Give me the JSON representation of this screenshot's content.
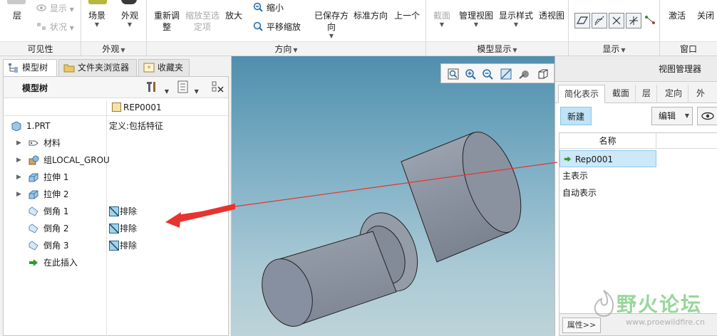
{
  "ribbon": {
    "visibility_group": {
      "label": "可见性",
      "layer_label": "层",
      "show_label": "显示",
      "status_label": "状况"
    },
    "appearance_group": {
      "label": "外观",
      "scene_label": "场景",
      "appearance_label": "外观"
    },
    "orientation_group": {
      "label": "方向",
      "refit_label": "重新调整",
      "zoom_to_selected_label": "缩放至选定项",
      "zoom_in_label": "放大",
      "zoom_out_label": "缩小",
      "pan_zoom_label": "平移缩放",
      "saved_orientations_label": "已保存方向",
      "standard_orientation_label": "标准方向",
      "previous_label": "上一个"
    },
    "model_display_group": {
      "label": "模型显示",
      "section_label": "截面",
      "manage_views_label": "管理视图",
      "display_style_label": "显示样式",
      "perspective_label": "透视图"
    },
    "display_group": {
      "label": "显示"
    },
    "window_group": {
      "label": "窗口",
      "activate_label": "激活",
      "close_label": "关闭"
    }
  },
  "left_panel": {
    "tabs": [
      {
        "label": "模型树",
        "icon": "model-tree-icon"
      },
      {
        "label": "文件夹浏览器",
        "icon": "folder-browser-icon"
      },
      {
        "label": "收藏夹",
        "icon": "favorites-icon"
      }
    ],
    "header_title": "模型树",
    "column2_header": "REP0001",
    "rows": [
      {
        "label": "1.PRT",
        "col2": "定义:包括特征",
        "icon": "part-icon"
      },
      {
        "label": "材料",
        "col2": "",
        "icon": "material-icon"
      },
      {
        "label": "组LOCAL_GROU",
        "col2": "",
        "icon": "group-icon"
      },
      {
        "label": "拉伸 1",
        "col2": "",
        "icon": "extrude-icon"
      },
      {
        "label": "拉伸 2",
        "col2": "",
        "icon": "extrude-icon"
      },
      {
        "label": "倒角 1",
        "col2": "排除",
        "icon": "chamfer-icon"
      },
      {
        "label": "倒角 2",
        "col2": "排除",
        "icon": "chamfer-icon"
      },
      {
        "label": "倒角 3",
        "col2": "排除",
        "icon": "chamfer-icon"
      },
      {
        "label": "在此插入",
        "col2": "",
        "icon": "insert-here-icon"
      }
    ]
  },
  "view_manager": {
    "title": "视图管理器",
    "tabs": [
      "简化表示",
      "截面",
      "层",
      "定向",
      "外观"
    ],
    "new_label": "新建",
    "edit_label": "编辑",
    "list_header": "名称",
    "items": [
      "Rep0001",
      "主表示",
      "自动表示"
    ],
    "properties_label": "属性>>"
  },
  "watermark": {
    "text_cn": "野火论坛",
    "url": "www.proewildfire.cn"
  },
  "colors": {
    "accent": "#bfe3f7",
    "selection": "#cde8f9",
    "annotation_arrow": "#e8332e",
    "model_body": "#8e96a4",
    "background_top": "#4f8fad",
    "background_bottom": "#bdd3d8"
  }
}
